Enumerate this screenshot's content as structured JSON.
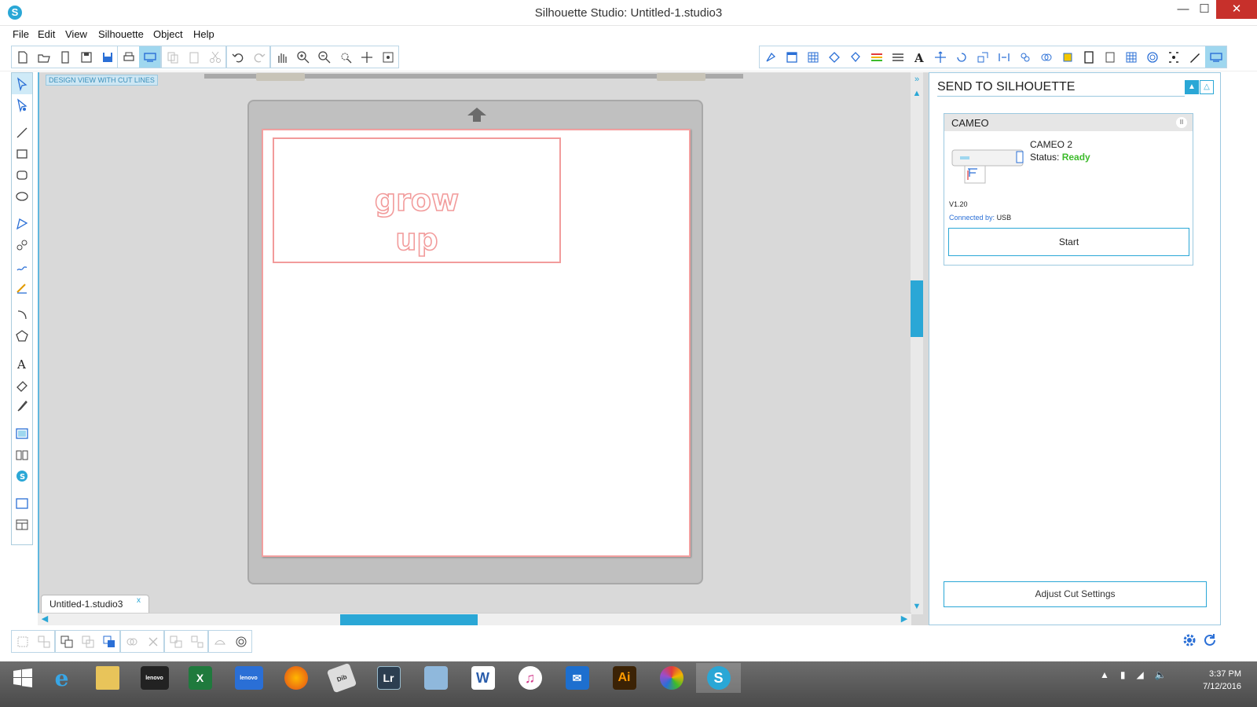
{
  "window": {
    "title": "Silhouette Studio: Untitled-1.studio3",
    "minimize": "—",
    "maximize": "☐",
    "close": "✕"
  },
  "menu": [
    "File",
    "Edit",
    "View",
    "Silhouette",
    "Object",
    "Help"
  ],
  "canvas": {
    "view_label": "DESIGN VIEW WITH CUT LINES",
    "text_lines": [
      "grow",
      "up"
    ]
  },
  "document_tab": {
    "label": "Untitled-1.studio3",
    "close": "x"
  },
  "panel": {
    "title": "SEND TO SILHOUETTE",
    "device_header": "CAMEO",
    "device_name": "CAMEO 2",
    "status_label": "Status:",
    "status_value": "Ready",
    "version": "V1.20",
    "connected_label": "Connected by:",
    "connected_value": "USB",
    "start_button": "Start",
    "adjust_button": "Adjust Cut Settings",
    "status_color": "#3dbb2c"
  },
  "accent_color": "#2aa7d6",
  "taskbar": {
    "items": [
      "internet-explorer",
      "file-explorer",
      "lenovo-photos",
      "excel",
      "lenovo-desktop",
      "firefox",
      "dib2pdf",
      "lightroom",
      "control-panel",
      "word",
      "itunes",
      "mail",
      "illustrator",
      "picasa",
      "silhouette-studio"
    ],
    "lenovo_label": "lenovo",
    "lightroom_label": "Lr",
    "word_label": "W",
    "illustrator_label": "Ai",
    "excel_label": "X",
    "time": "3:37 PM",
    "date": "7/12/2016"
  }
}
